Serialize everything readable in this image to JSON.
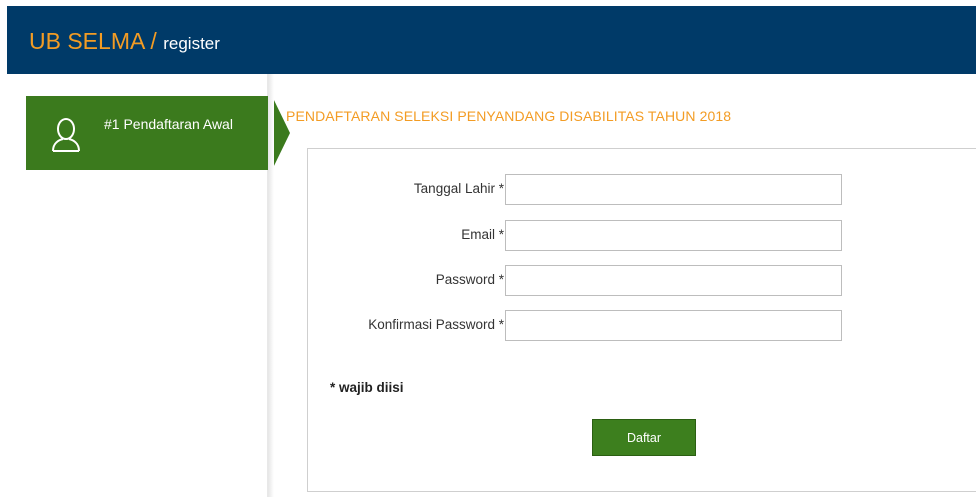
{
  "header": {
    "brand": "UB SELMA / ",
    "sub": "register"
  },
  "sidebar": {
    "steps": [
      {
        "label": "#1 Pendaftaran Awal",
        "icon": "user-outline-icon",
        "active": true
      }
    ]
  },
  "main": {
    "title": "PENDAFTARAN SELEKSI PENYANDANG DISABILITAS TAHUN 2018",
    "form": {
      "fields": [
        {
          "label": "Tanggal Lahir *",
          "value": "",
          "placeholder": ""
        },
        {
          "label": "Email *",
          "value": "",
          "placeholder": ""
        },
        {
          "label": "Password *",
          "value": "",
          "placeholder": ""
        },
        {
          "label": "Konfirmasi Password *",
          "value": "",
          "placeholder": ""
        }
      ],
      "required_note": "* wajib diisi",
      "submit_label": "Daftar"
    }
  },
  "colors": {
    "header_bg": "#003a68",
    "accent_orange": "#f39c24",
    "step_green": "#3b7a1d"
  }
}
